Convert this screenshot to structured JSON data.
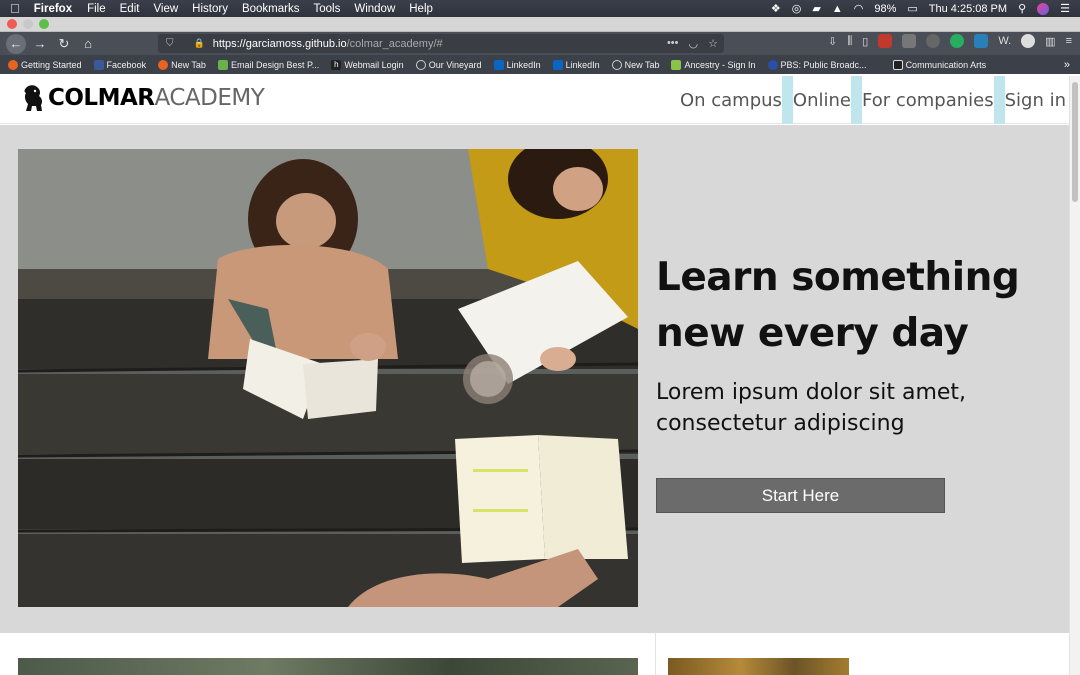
{
  "menubar": {
    "app": "Firefox",
    "items": [
      "File",
      "Edit",
      "View",
      "History",
      "Bookmarks",
      "Tools",
      "Window",
      "Help"
    ],
    "battery": "98%",
    "clock": "Thu 4:25:08 PM"
  },
  "browser": {
    "url_host": "https://garciamoss.github.io",
    "url_path": "/colmar_academy/#",
    "url_more": "•••",
    "bookmarks": [
      {
        "label": "Getting Started",
        "color": "#e8631f"
      },
      {
        "label": "Facebook",
        "color": "#3b5998"
      },
      {
        "label": "New Tab",
        "color": "#e8631f"
      },
      {
        "label": "Email Design Best P...",
        "color": "#6ab04c"
      },
      {
        "label": "Webmail Login",
        "color": "#222222"
      },
      {
        "label": "Our Vineyard",
        "color": "#777777"
      },
      {
        "label": "LinkedIn",
        "color": "#0a66c2"
      },
      {
        "label": "LinkedIn",
        "color": "#0a66c2"
      },
      {
        "label": "New Tab",
        "color": "#777777"
      },
      {
        "label": "Ancestry - Sign In",
        "color": "#8bc34a"
      },
      {
        "label": "PBS: Public Broadc...",
        "color": "#2a4fa8"
      },
      {
        "label": "Communication Arts",
        "color": "#222222"
      }
    ],
    "bookmarks_overflow": "»"
  },
  "site": {
    "logo_bold": "COLMAR",
    "logo_light": "ACADEMY",
    "nav": [
      "On campus",
      "Online",
      "For companies",
      "Sign in"
    ],
    "hero": {
      "title": "Learn something new every day",
      "subtitle": "Lorem ipsum dolor sit amet, consectetur adipiscing",
      "cta": "Start Here"
    }
  }
}
